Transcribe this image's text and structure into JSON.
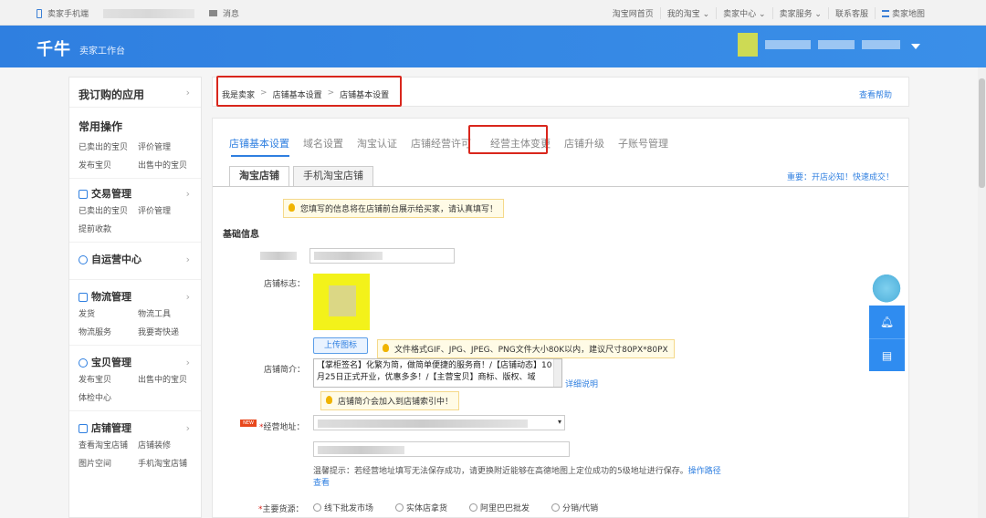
{
  "topbar": {
    "seller_phone": "卖家手机端",
    "messages": "消息",
    "links": [
      "淘宝网首页",
      "我的淘宝 ⌄",
      "卖家中心 ⌄",
      "卖家服务 ⌄",
      "联系客服",
      "卖家地图"
    ]
  },
  "header": {
    "logo": "千牛",
    "subtitle": "卖家工作台"
  },
  "sidebar": {
    "title": "我订购的应用",
    "common_title": "常用操作",
    "common_items": [
      "已卖出的宝贝",
      "评价管理",
      "发布宝贝",
      "出售中的宝贝"
    ],
    "sections": [
      {
        "title": "交易管理",
        "items": [
          "已卖出的宝贝",
          "评价管理",
          "提前收款"
        ]
      },
      {
        "title": "自运营中心",
        "items": []
      },
      {
        "title": "物流管理",
        "items": [
          "发货",
          "物流工具",
          "物流服务",
          "我要寄快递"
        ]
      },
      {
        "title": "宝贝管理",
        "items": [
          "发布宝贝",
          "出售中的宝贝",
          "体检中心"
        ]
      },
      {
        "title": "店铺管理",
        "items": [
          "查看淘宝店铺",
          "店铺装修",
          "图片空间",
          "手机淘宝店铺"
        ]
      }
    ]
  },
  "breadcrumb": {
    "items": [
      "我是卖家",
      "店铺基本设置",
      "店铺基本设置"
    ],
    "sep": ">",
    "help": "查看帮助"
  },
  "tabs": [
    "店铺基本设置",
    "域名设置",
    "淘宝认证",
    "店铺经营许可",
    "经营主体变更",
    "店铺升级",
    "子账号管理"
  ],
  "subtabs": [
    "淘宝店铺",
    "手机淘宝店铺"
  ],
  "notice_right": "重要：开店必知！快速成交！",
  "tip_top": "您填写的信息将在店铺前台展示给买家，请认真填写！",
  "section_basic": "基础信息",
  "form": {
    "logo_label": "店铺标志：",
    "upload_button": "上传图标",
    "logo_tip": "文件格式GIF、JPG、JPEG、PNG文件大小80K以内，建议尺寸80PX*80PX",
    "intro_label": "店铺简介：",
    "intro_text": "【掌柜签名】化繁为简，做简单便捷的服务商！/【店铺动态】10月25日正式开业，优惠多多！/【主营宝贝】商标、版权、域",
    "intro_link": "详细说明",
    "intro_tip": "店铺简介会加入到店铺索引中！",
    "address_label": "经营地址：",
    "new_badge": "NEW",
    "warm_tip": "温馨提示：若经营地址填写无法保存成功，请更换附近能够在高德地图上定位成功的5级地址进行保存。",
    "warm_link": "操作路径查看",
    "source_label": "主要货源：",
    "source_options": [
      "线下批发市场",
      "实体店拿货",
      "阿里巴巴批发",
      "分销/代销"
    ]
  },
  "colors": {
    "accent": "#2f7fe0",
    "highlight": "#d9261c"
  }
}
